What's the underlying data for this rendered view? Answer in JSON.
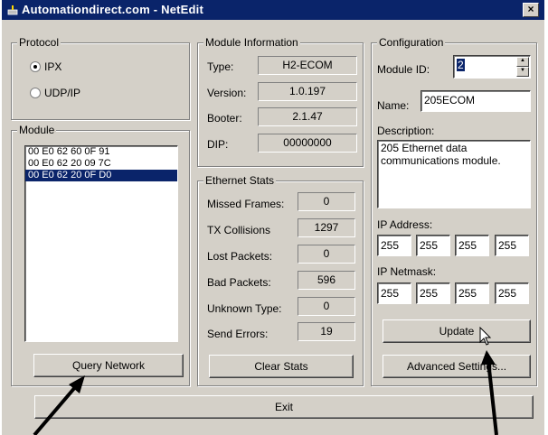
{
  "window": {
    "title": "Automationdirect.com - NetEdit",
    "close_glyph": "×"
  },
  "protocol": {
    "legend": "Protocol",
    "options": [
      {
        "label": "IPX",
        "selected": true
      },
      {
        "label": "UDP/IP",
        "selected": false
      }
    ]
  },
  "module": {
    "legend": "Module",
    "items": [
      "00 E0 62 60 0F 91",
      "00 E0 62 20 09 7C",
      "00 E0 62 20 0F D0"
    ],
    "selected_index": 2,
    "query_button": "Query Network"
  },
  "module_info": {
    "legend": "Module Information",
    "type_label": "Type:",
    "type_value": "H2-ECOM",
    "version_label": "Version:",
    "version_value": "1.0.197",
    "booter_label": "Booter:",
    "booter_value": "2.1.47",
    "dip_label": "DIP:",
    "dip_value": "00000000"
  },
  "ethernet_stats": {
    "legend": "Ethernet Stats",
    "rows": [
      {
        "label": "Missed Frames:",
        "value": "0"
      },
      {
        "label": "TX Collisions",
        "value": "1297"
      },
      {
        "label": "Lost Packets:",
        "value": "0"
      },
      {
        "label": "Bad Packets:",
        "value": "596"
      },
      {
        "label": "Unknown Type:",
        "value": "0"
      },
      {
        "label": "Send Errors:",
        "value": "19"
      }
    ],
    "clear_button": "Clear Stats"
  },
  "configuration": {
    "legend": "Configuration",
    "module_id_label": "Module ID:",
    "module_id_value": "2",
    "name_label": "Name:",
    "name_value": "205ECOM",
    "description_label": "Description:",
    "description_value": "205 Ethernet data communications module.",
    "ip_address_label": "IP Address:",
    "ip_address": [
      "255",
      "255",
      "255",
      "255"
    ],
    "ip_netmask_label": "IP Netmask:",
    "ip_netmask": [
      "255",
      "255",
      "255",
      "255"
    ],
    "update_button": "Update",
    "advanced_button": "Advanced Settings..."
  },
  "exit_button": "Exit",
  "colors": {
    "titlebar": "#0a246a",
    "face": "#d4d0c8",
    "selection": "#0a246a"
  }
}
